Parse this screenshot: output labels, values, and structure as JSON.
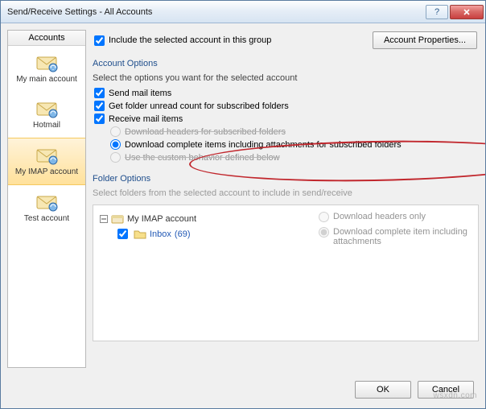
{
  "window": {
    "title": "Send/Receive Settings - All Accounts"
  },
  "sidebar": {
    "header": "Accounts",
    "items": [
      {
        "label": "My main account"
      },
      {
        "label": "Hotmail"
      },
      {
        "label": "My IMAP account"
      },
      {
        "label": "Test account"
      }
    ],
    "selected_index": 2
  },
  "include": {
    "label": "Include the selected account in this group",
    "checked": true
  },
  "buttons": {
    "account_properties": "Account Properties...",
    "ok": "OK",
    "cancel": "Cancel"
  },
  "account_options": {
    "title": "Account Options",
    "hint": "Select the options you want for the selected account",
    "send_mail": {
      "label": "Send mail items",
      "checked": true
    },
    "unread_count": {
      "label": "Get folder unread count for subscribed folders",
      "checked": true
    },
    "receive_mail": {
      "label": "Receive mail items",
      "checked": true
    },
    "mode": {
      "headers": "Download headers for subscribed folders",
      "complete": "Download complete items including attachments for subscribed folders",
      "custom": "Use the custom behavior defined below",
      "selected": "complete"
    }
  },
  "folder_options": {
    "title": "Folder Options",
    "hint": "Select folders from the selected account to include in send/receive",
    "tree": {
      "root": "My IMAP account",
      "inbox_label": "Inbox",
      "inbox_count": "(69)",
      "inbox_checked": true
    },
    "radio": {
      "headers": "Download headers only",
      "complete": "Download complete item including attachments",
      "selected": "complete"
    }
  },
  "watermark": "wsxdn.com"
}
